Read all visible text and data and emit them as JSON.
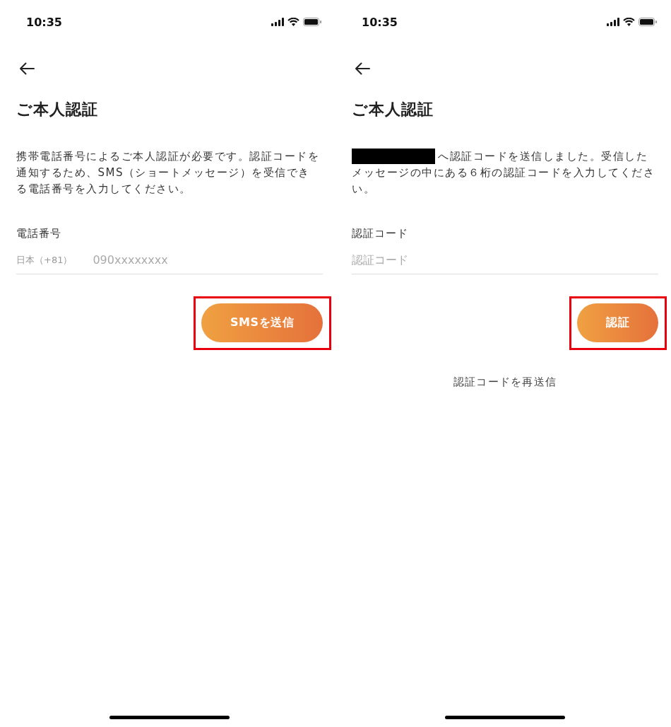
{
  "screens": [
    {
      "status_bar": {
        "time": "10:35"
      },
      "title": "ご本人認証",
      "message": {
        "redacted": false,
        "lines": [
          "携帯電話番号によるご本人認証が必要です。認証コードを",
          "通知するため、SMS（ショートメッセージ）を受信でき",
          "る電話番号を入力してください。"
        ]
      },
      "field": {
        "label": "電話番号",
        "country_code": "日本（+81）",
        "placeholder": "090xxxxxxxx"
      },
      "button": {
        "label": "SMSを送信",
        "highlighted": true
      }
    },
    {
      "status_bar": {
        "time": "10:35"
      },
      "title": "ご本人認証",
      "message": {
        "redacted": true,
        "lines": [
          "へ認証コードを送信しました。受信した",
          "メッセージの中にある６桁の認証コードを入力してくださ",
          "い。"
        ]
      },
      "field": {
        "label": "認証コード",
        "placeholder": "認証コード"
      },
      "button": {
        "label": "認証",
        "highlighted": true
      },
      "resend_link": "認証コードを再送信"
    }
  ]
}
